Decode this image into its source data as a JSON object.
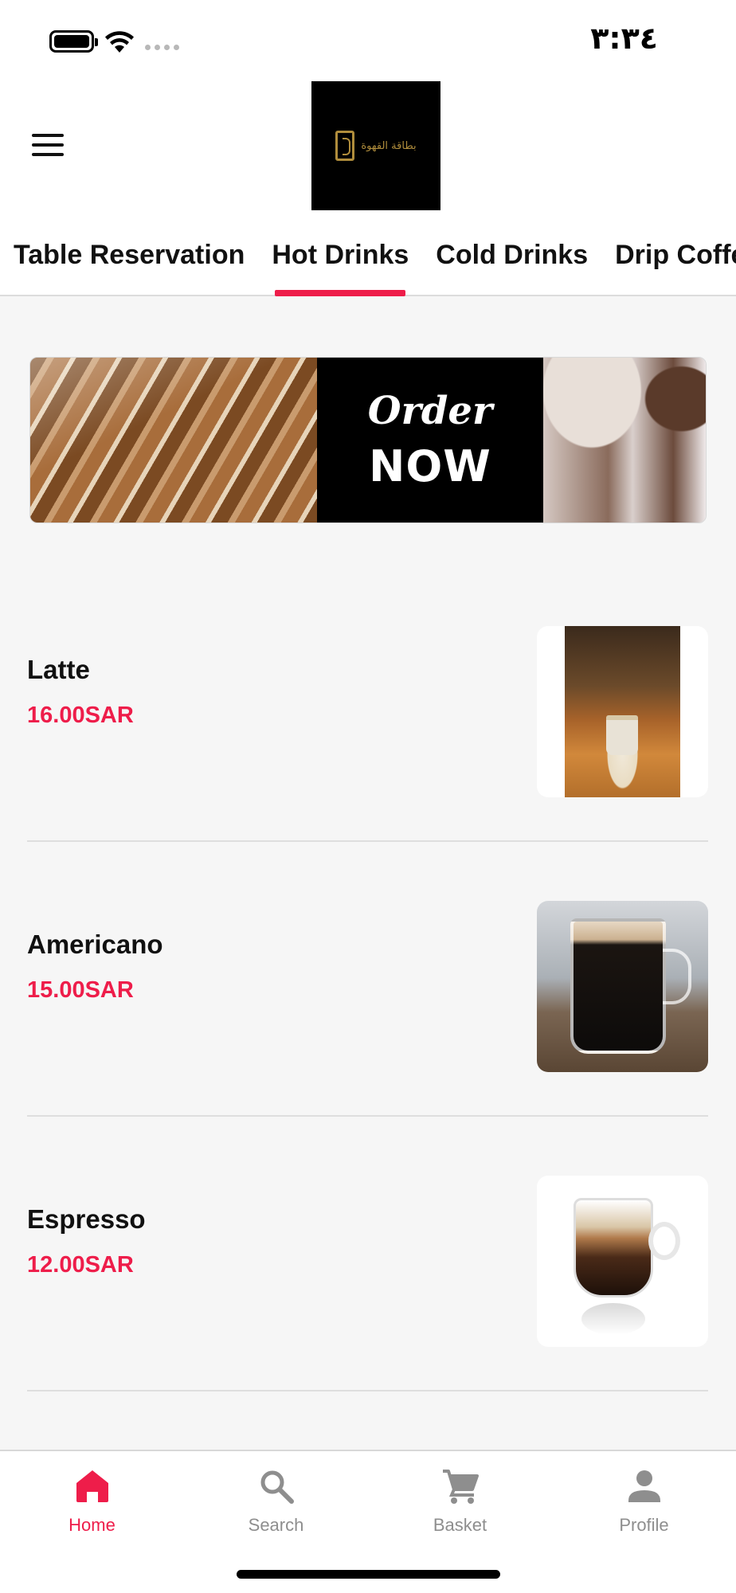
{
  "status_bar": {
    "time": "٣:٣٤",
    "battery_icon": "battery-icon",
    "wifi_icon": "wifi-icon",
    "signal_icon": "signal-dots-icon"
  },
  "header": {
    "menu_icon": "hamburger-menu-icon",
    "logo_text": "بطاقة القهوة",
    "tabs": [
      {
        "label": "Table Reservation",
        "active": false
      },
      {
        "label": "Hot Drinks",
        "active": true
      },
      {
        "label": "Cold Drinks",
        "active": false
      },
      {
        "label": "Drip Coffee",
        "active": false
      }
    ]
  },
  "banner": {
    "line1": "Order",
    "line2": "NOW"
  },
  "products": [
    {
      "name": "Latte",
      "price": "16.00SAR",
      "image": "latte-photo"
    },
    {
      "name": "Americano",
      "price": "15.00SAR",
      "image": "americano-photo"
    },
    {
      "name": "Espresso",
      "price": "12.00SAR",
      "image": "espresso-photo"
    }
  ],
  "bottom_nav": [
    {
      "label": "Home",
      "icon": "home-icon",
      "active": true
    },
    {
      "label": "Search",
      "icon": "search-icon",
      "active": false
    },
    {
      "label": "Basket",
      "icon": "cart-icon",
      "active": false
    },
    {
      "label": "Profile",
      "icon": "person-icon",
      "active": false
    }
  ],
  "colors": {
    "accent": "#ee1d4a",
    "inactive_nav": "#8e8e8e",
    "logo_gold": "#b08d3c",
    "background": "#f6f6f6"
  }
}
